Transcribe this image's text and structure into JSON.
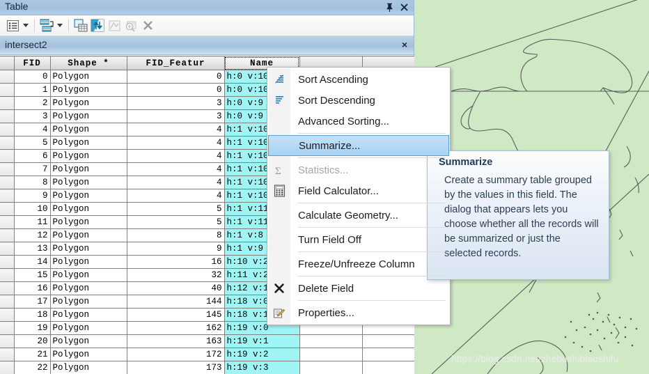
{
  "panel": {
    "title": "Table",
    "pin_icon": "pin-icon",
    "close_icon": "close-icon"
  },
  "toolbar": {
    "buttons": [
      {
        "name": "table-options-icon",
        "label": "Table Options"
      },
      {
        "name": "table-options-dropdown-caret",
        "label": ""
      },
      {
        "name": "related-tables-icon",
        "label": "Related Tables"
      },
      {
        "name": "related-tables-dropdown-caret",
        "label": ""
      },
      {
        "name": "select-by-attributes-icon",
        "label": "Select By Attributes"
      },
      {
        "name": "switch-selection-icon",
        "label": "Switch Selection"
      },
      {
        "name": "zoom-to-selected-icon",
        "label": "Zoom To Selected"
      },
      {
        "name": "zoom-selected-magnifier-icon",
        "label": "Zoom"
      },
      {
        "name": "clear-selection-icon",
        "label": "Clear Selection"
      }
    ]
  },
  "tab": {
    "label": "intersect2",
    "close_label": "×"
  },
  "grid": {
    "columns": [
      "FID",
      "Shape *",
      "FID_Featur",
      "Name"
    ],
    "selected_column": "Name",
    "rows": [
      {
        "fid": "0",
        "shape": "Polygon",
        "fid_featur": "0",
        "name": "h:0 v:10"
      },
      {
        "fid": "1",
        "shape": "Polygon",
        "fid_featur": "0",
        "name": "h:0 v:10"
      },
      {
        "fid": "2",
        "shape": "Polygon",
        "fid_featur": "3",
        "name": "h:0 v:9"
      },
      {
        "fid": "3",
        "shape": "Polygon",
        "fid_featur": "3",
        "name": "h:0 v:9"
      },
      {
        "fid": "4",
        "shape": "Polygon",
        "fid_featur": "4",
        "name": "h:1 v:10"
      },
      {
        "fid": "5",
        "shape": "Polygon",
        "fid_featur": "4",
        "name": "h:1 v:10"
      },
      {
        "fid": "6",
        "shape": "Polygon",
        "fid_featur": "4",
        "name": "h:1 v:10"
      },
      {
        "fid": "7",
        "shape": "Polygon",
        "fid_featur": "4",
        "name": "h:1 v:10"
      },
      {
        "fid": "8",
        "shape": "Polygon",
        "fid_featur": "4",
        "name": "h:1 v:10"
      },
      {
        "fid": "9",
        "shape": "Polygon",
        "fid_featur": "4",
        "name": "h:1 v:10"
      },
      {
        "fid": "10",
        "shape": "Polygon",
        "fid_featur": "5",
        "name": "h:1 v:11"
      },
      {
        "fid": "11",
        "shape": "Polygon",
        "fid_featur": "5",
        "name": "h:1 v:11"
      },
      {
        "fid": "12",
        "shape": "Polygon",
        "fid_featur": "8",
        "name": "h:1 v:8"
      },
      {
        "fid": "13",
        "shape": "Polygon",
        "fid_featur": "9",
        "name": "h:1 v:9"
      },
      {
        "fid": "14",
        "shape": "Polygon",
        "fid_featur": "16",
        "name": "h:10 v:2"
      },
      {
        "fid": "15",
        "shape": "Polygon",
        "fid_featur": "32",
        "name": "h:11 v:2"
      },
      {
        "fid": "16",
        "shape": "Polygon",
        "fid_featur": "40",
        "name": "h:12 v:1"
      },
      {
        "fid": "17",
        "shape": "Polygon",
        "fid_featur": "144",
        "name": "h:18 v:0"
      },
      {
        "fid": "18",
        "shape": "Polygon",
        "fid_featur": "145",
        "name": "h:18 v:1"
      },
      {
        "fid": "19",
        "shape": "Polygon",
        "fid_featur": "162",
        "name": "h:19 v:0"
      },
      {
        "fid": "20",
        "shape": "Polygon",
        "fid_featur": "163",
        "name": "h:19 v:1"
      },
      {
        "fid": "21",
        "shape": "Polygon",
        "fid_featur": "172",
        "name": "h:19 v:2"
      },
      {
        "fid": "22",
        "shape": "Polygon",
        "fid_featur": "173",
        "name": "h:19 v:3"
      }
    ]
  },
  "context_menu": {
    "items": [
      {
        "label": "Sort Ascending",
        "icon": "sort-ascending-icon",
        "state": "normal"
      },
      {
        "label": "Sort Descending",
        "icon": "sort-descending-icon",
        "state": "normal"
      },
      {
        "label": "Advanced Sorting...",
        "icon": "",
        "state": "normal"
      },
      {
        "label": "Summarize...",
        "icon": "",
        "state": "highlight"
      },
      {
        "label": "Statistics...",
        "icon": "sigma-icon",
        "state": "disabled"
      },
      {
        "label": "Field Calculator...",
        "icon": "calculator-icon",
        "state": "normal"
      },
      {
        "label": "Calculate Geometry...",
        "icon": "",
        "state": "normal"
      },
      {
        "label": "Turn Field Off",
        "icon": "",
        "state": "normal"
      },
      {
        "label": "Freeze/Unfreeze Column",
        "icon": "",
        "state": "normal"
      },
      {
        "label": "Delete Field",
        "icon": "delete-x-icon",
        "state": "normal"
      },
      {
        "label": "Properties...",
        "icon": "properties-icon",
        "state": "normal"
      }
    ]
  },
  "tooltip": {
    "title": "Summarize",
    "body": "Create a summary table grouped by the values in this field. The dialog that appears lets you choose whether all the records will be summarized or just the selected records."
  },
  "map": {
    "watermark": "https://blog.csdn.net/zhebushibiaoshifu",
    "background_color": "#cfe9c4",
    "outline_color": "#5a5a5a"
  },
  "colors": {
    "titlebar": "#a6c3de",
    "selection_highlight": "#a9d2f4",
    "name_cell": "#9ff4f4",
    "map_green": "#cfe9c4"
  }
}
